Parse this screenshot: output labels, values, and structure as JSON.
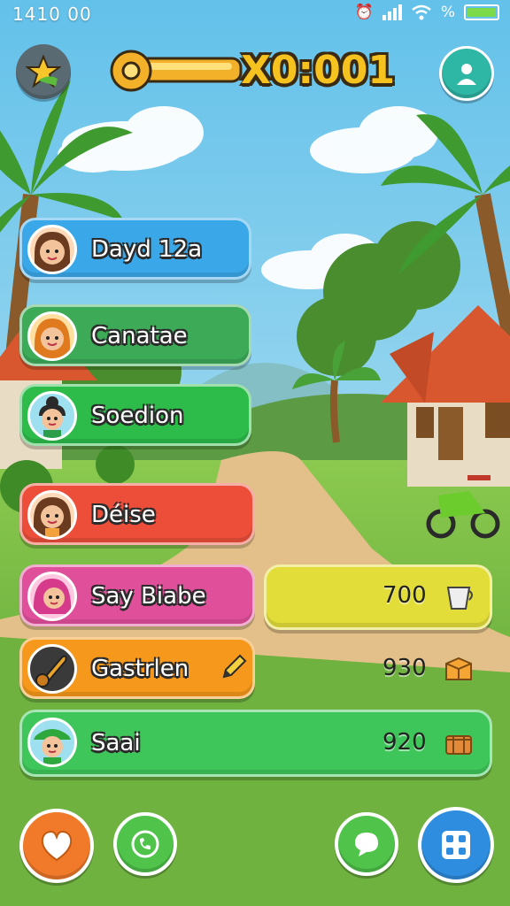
{
  "status_bar": {
    "time": "1410 00",
    "battery_level": 1.0
  },
  "header": {
    "counter": "X0:001"
  },
  "players": [
    {
      "name": "Dayd 12a",
      "color": "#3aa8e8"
    },
    {
      "name": "Canatae",
      "color": "#3daa58"
    },
    {
      "name": "Soedion",
      "color": "#2dbb4a"
    },
    {
      "name": "Déise",
      "color": "#ec4e3a"
    },
    {
      "name": "Say Biabe",
      "color": "#e0509a",
      "score": "700"
    },
    {
      "name": "Gastrlen",
      "color": "#f5981c",
      "score": "930"
    },
    {
      "name": "Saai",
      "color": "#3fc65a",
      "score": "920"
    }
  ],
  "icons": {
    "top_left": "star-icon",
    "top_right": "profile-icon",
    "bottom": [
      "heart-icon",
      "phone-icon",
      "chat-icon",
      "menu-icon"
    ]
  },
  "colors": {
    "sky": "#9fd8ef",
    "grass": "#84c14a",
    "path": "#e6c38a"
  }
}
